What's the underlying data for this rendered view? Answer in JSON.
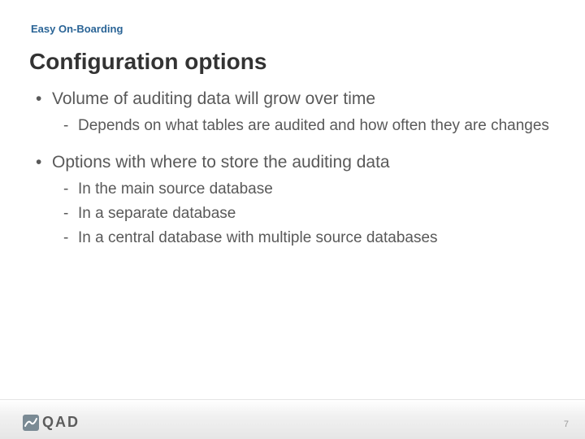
{
  "header": "Easy On-Boarding",
  "title": "Configuration options",
  "bullets": [
    {
      "text": "Volume of auditing data will grow over time",
      "sub": [
        "Depends on what tables are audited and how often they are changes"
      ]
    },
    {
      "text": "Options with where to store the auditing data",
      "sub": [
        "In the main source database",
        "In a separate database",
        "In a central database with multiple source databases"
      ]
    }
  ],
  "logo_text": "QAD",
  "page_number": "7"
}
